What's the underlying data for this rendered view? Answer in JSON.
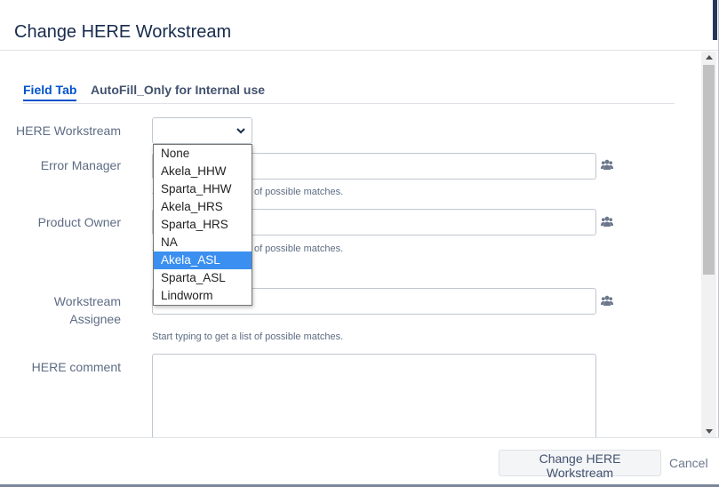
{
  "dialog": {
    "title": "Change HERE Workstream"
  },
  "tabs": [
    {
      "label": "Field Tab",
      "active": true
    },
    {
      "label": "AutoFill_Only for Internal use",
      "active": false
    }
  ],
  "fields": {
    "workstream": {
      "label": "HERE Workstream",
      "value": ""
    },
    "error_manager": {
      "label": "Error Manager",
      "value": "",
      "hint": "Start typing to get a list of possible matches."
    },
    "product_owner": {
      "label": "Product Owner",
      "value": "",
      "hint": "Start typing to get a list of possible matches."
    },
    "workstream_assignee": {
      "label_line1": "Workstream",
      "label_line2": "Assignee",
      "value": "",
      "hint": "Start typing to get a list of possible matches."
    },
    "comment": {
      "label": "HERE comment",
      "value": ""
    }
  },
  "dropdown": {
    "options": [
      "None",
      "Akela_HHW",
      "Sparta_HHW",
      "Akela_HRS",
      "Sparta_HRS",
      "NA",
      "Akela_ASL",
      "Sparta_ASL",
      "Lindworm"
    ],
    "highlighted": "Akela_ASL"
  },
  "footer": {
    "primary_label": "Change HERE Workstream",
    "cancel_label": "Cancel"
  },
  "colors": {
    "accent": "#0052cc",
    "highlight": "#3b8ff0",
    "muted": "#5e6c84"
  },
  "icons": {
    "picker": "people-group-icon",
    "select": "chevron-down-icon"
  }
}
